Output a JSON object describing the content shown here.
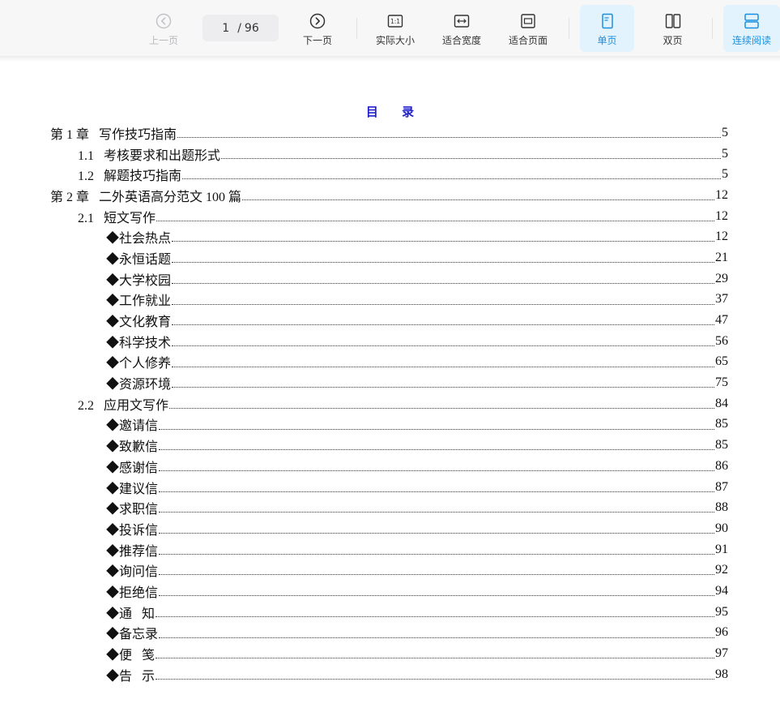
{
  "toolbar": {
    "prev_label": "上一页",
    "next_label": "下一页",
    "page_current": "1",
    "page_sep": "/",
    "page_total": "96",
    "actual_size_label": "实际大小",
    "fit_width_label": "适合宽度",
    "fit_page_label": "适合页面",
    "single_page_label": "单页",
    "double_page_label": "双页",
    "continuous_label": "连续阅读",
    "active_color": "#1a8fe0",
    "active_bg": "#e3f3fd"
  },
  "document": {
    "title": "目 录",
    "toc": [
      {
        "level": 0,
        "text": "第 1 章   写作技巧指南",
        "page": "5"
      },
      {
        "level": 1,
        "text": "1.1   考核要求和出题形式",
        "page": "5"
      },
      {
        "level": 1,
        "text": "1.2   解题技巧指南",
        "page": "5"
      },
      {
        "level": 0,
        "text": "第 2 章   二外英语高分范文 100 篇",
        "page": "12"
      },
      {
        "level": 1,
        "text": "2.1   短文写作",
        "page": "12"
      },
      {
        "level": 2,
        "text": "◆社会热点",
        "page": "12"
      },
      {
        "level": 2,
        "text": "◆永恒话题",
        "page": "21"
      },
      {
        "level": 2,
        "text": "◆大学校园",
        "page": "29"
      },
      {
        "level": 2,
        "text": "◆工作就业",
        "page": "37"
      },
      {
        "level": 2,
        "text": "◆文化教育",
        "page": "47"
      },
      {
        "level": 2,
        "text": "◆科学技术",
        "page": "56"
      },
      {
        "level": 2,
        "text": "◆个人修养",
        "page": "65"
      },
      {
        "level": 2,
        "text": "◆资源环境",
        "page": "75"
      },
      {
        "level": 1,
        "text": "2.2   应用文写作",
        "page": "84"
      },
      {
        "level": 2,
        "text": "◆邀请信",
        "page": "85"
      },
      {
        "level": 2,
        "text": "◆致歉信",
        "page": "85"
      },
      {
        "level": 2,
        "text": "◆感谢信",
        "page": "86"
      },
      {
        "level": 2,
        "text": "◆建议信",
        "page": "87"
      },
      {
        "level": 2,
        "text": "◆求职信",
        "page": "88"
      },
      {
        "level": 2,
        "text": "◆投诉信",
        "page": "90"
      },
      {
        "level": 2,
        "text": "◆推荐信",
        "page": "91"
      },
      {
        "level": 2,
        "text": "◆询问信",
        "page": "92"
      },
      {
        "level": 2,
        "text": "◆拒绝信",
        "page": "94"
      },
      {
        "level": 2,
        "text": "◆通   知",
        "page": "95"
      },
      {
        "level": 2,
        "text": "◆备忘录",
        "page": "96"
      },
      {
        "level": 2,
        "text": "◆便   笺",
        "page": "97"
      },
      {
        "level": 2,
        "text": "◆告   示",
        "page": "98"
      }
    ]
  }
}
